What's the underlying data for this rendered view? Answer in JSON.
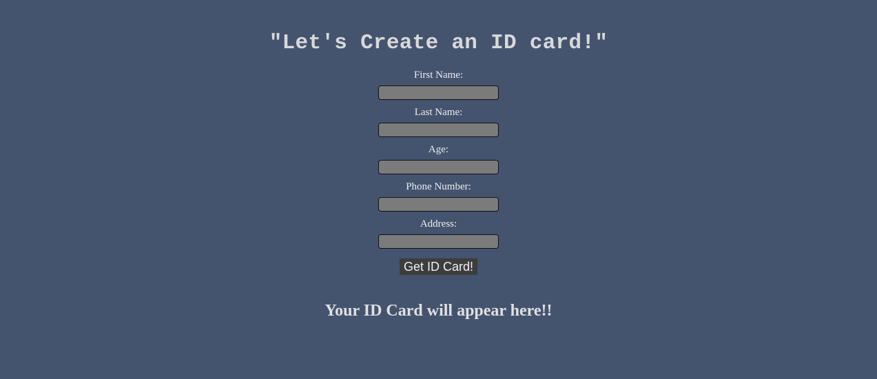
{
  "header": {
    "title": "\"Let's Create an ID card!\""
  },
  "form": {
    "fields": [
      {
        "label": "First Name:",
        "value": ""
      },
      {
        "label": "Last Name:",
        "value": ""
      },
      {
        "label": "Age:",
        "value": ""
      },
      {
        "label": "Phone Number:",
        "value": ""
      },
      {
        "label": "Address:",
        "value": ""
      }
    ],
    "submit_label": "Get ID Card!"
  },
  "result": {
    "message": "Your ID Card will appear here!!"
  },
  "colors": {
    "background": "#44546f",
    "input_fill": "#7b7b7b",
    "button_fill": "#3d3d3d"
  }
}
